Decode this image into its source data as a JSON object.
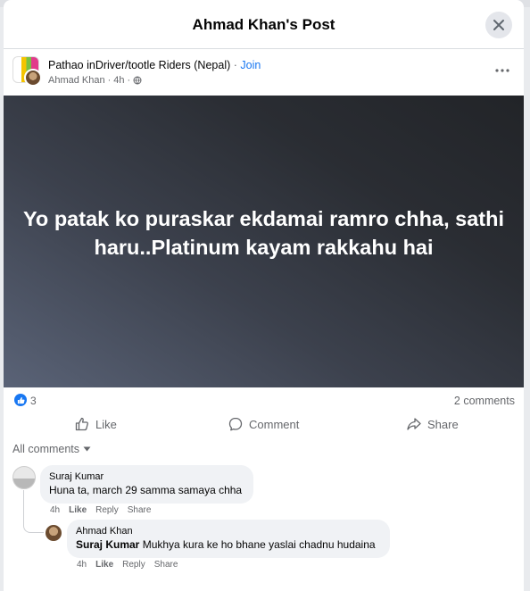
{
  "dialog": {
    "title": "Ahmad Khan's Post"
  },
  "post": {
    "group_name": "Pathao inDriver/tootle Riders (Nepal)",
    "separator": "·",
    "join_label": "Join",
    "author": "Ahmad Khan",
    "time": "4h",
    "media_text": "Yo patak ko puraskar ekdamai ramro chha, sathi haru..Platinum kayam rakkahu hai"
  },
  "stats": {
    "reaction_count": "3",
    "comments_label": "2 comments"
  },
  "actions": {
    "like": "Like",
    "comment": "Comment",
    "share": "Share"
  },
  "comments_sort": {
    "label": "All comments"
  },
  "comments": [
    {
      "author": "Suraj Kumar",
      "text": "Huna ta, march 29 samma samaya chha",
      "time": "4h",
      "like": "Like",
      "reply": "Reply",
      "share": "Share"
    },
    {
      "author": "Ahmad Khan",
      "mention": "Suraj Kumar",
      "text": "Mukhya kura ke ho bhane yaslai chadnu hudaina",
      "time": "4h",
      "like": "Like",
      "reply": "Reply",
      "share": "Share"
    }
  ],
  "colors": {
    "accent": "#1877f2",
    "bubble": "#f0f2f5",
    "secondary_text": "#65676b"
  }
}
